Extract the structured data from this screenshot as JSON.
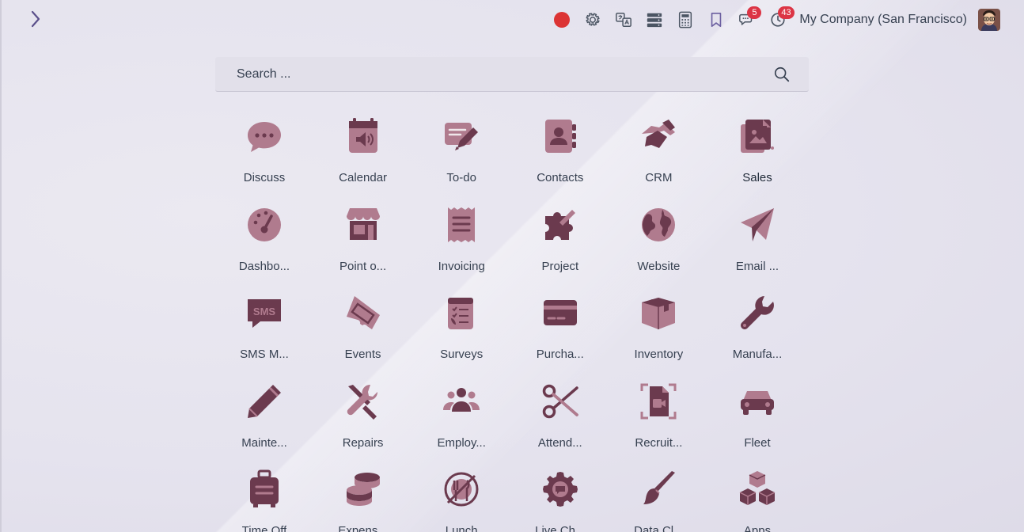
{
  "topbar": {
    "menu_toggle_icon": "chevron-right-icon",
    "tray": [
      {
        "name": "recording-dot",
        "icon": "record-icon"
      },
      {
        "name": "settings",
        "icon": "gear-icon"
      },
      {
        "name": "translate",
        "icon": "translate-icon"
      },
      {
        "name": "database",
        "icon": "server-icon"
      },
      {
        "name": "calculator",
        "icon": "calculator-icon"
      },
      {
        "name": "bookmarks",
        "icon": "bookmark-icon"
      },
      {
        "name": "messages",
        "icon": "chat-icon",
        "badge": "5"
      },
      {
        "name": "activities",
        "icon": "clock-icon",
        "badge": "43"
      }
    ],
    "company": "My Company (San Francisco)",
    "avatar_icon": "user-avatar"
  },
  "search": {
    "placeholder": "Search ...",
    "value": ""
  },
  "apps": [
    {
      "label": "Discuss",
      "icon": "chat-bubble-icon"
    },
    {
      "label": "Calendar",
      "icon": "calendar-speaker-icon"
    },
    {
      "label": "To-do",
      "icon": "note-pen-icon"
    },
    {
      "label": "Contacts",
      "icon": "address-book-icon"
    },
    {
      "label": "CRM",
      "icon": "handshake-icon"
    },
    {
      "label": "Sales",
      "icon": "sales-document-icon"
    },
    {
      "label": "Dashbo...",
      "icon": "dashboard-gauge-icon"
    },
    {
      "label": "Point o...",
      "icon": "shop-icon"
    },
    {
      "label": "Invoicing",
      "icon": "invoice-receipt-icon"
    },
    {
      "label": "Project",
      "icon": "puzzle-icon"
    },
    {
      "label": "Website",
      "icon": "globe-icon"
    },
    {
      "label": "Email ...",
      "icon": "paper-plane-icon"
    },
    {
      "label": "SMS M...",
      "icon": "sms-bubble-icon"
    },
    {
      "label": "Events",
      "icon": "ticket-icon"
    },
    {
      "label": "Surveys",
      "icon": "survey-clipboard-icon"
    },
    {
      "label": "Purcha...",
      "icon": "credit-card-icon"
    },
    {
      "label": "Inventory",
      "icon": "box-icon"
    },
    {
      "label": "Manufa...",
      "icon": "wrench-icon"
    },
    {
      "label": "Mainte...",
      "icon": "pencil-icon"
    },
    {
      "label": "Repairs",
      "icon": "tools-icon"
    },
    {
      "label": "Employ...",
      "icon": "people-icon"
    },
    {
      "label": "Attend...",
      "icon": "scissors-icon"
    },
    {
      "label": "Recruit...",
      "icon": "video-file-icon"
    },
    {
      "label": "Fleet",
      "icon": "car-icon"
    },
    {
      "label": "Time Off",
      "icon": "luggage-icon"
    },
    {
      "label": "Expens...",
      "icon": "coins-icon"
    },
    {
      "label": "Lunch",
      "icon": "lunch-plate-icon"
    },
    {
      "label": "Live Ch...",
      "icon": "cog-chat-icon"
    },
    {
      "label": "Data Cl...",
      "icon": "brush-icon"
    },
    {
      "label": "Apps",
      "icon": "cubes-icon"
    }
  ],
  "colors": {
    "icon_primary": "#6b3a4e",
    "icon_secondary": "#b07b8e",
    "badge": "#dc3545",
    "record": "#dc3434",
    "toggle": "#5a4f8a"
  }
}
